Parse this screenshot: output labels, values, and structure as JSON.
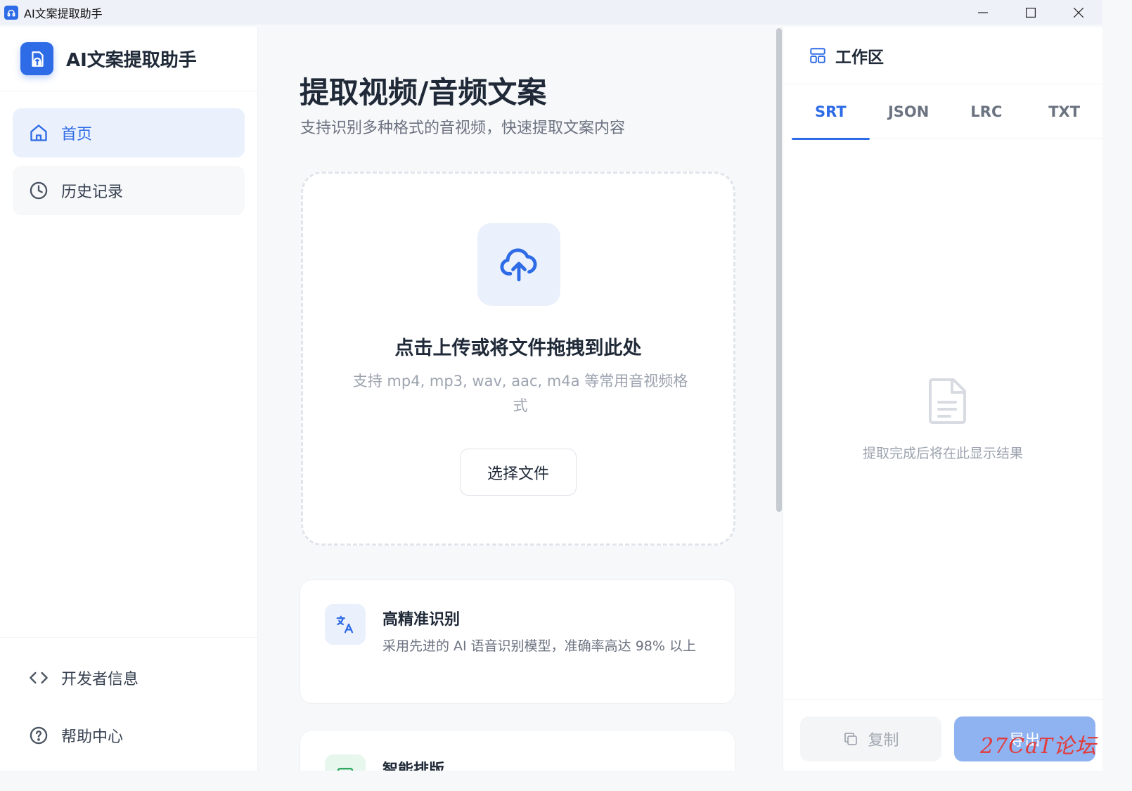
{
  "window": {
    "title": "AI文案提取助手"
  },
  "sidebar": {
    "brand": "AI文案提取助手",
    "items": [
      {
        "label": "首页",
        "icon": "home-icon",
        "active": true
      },
      {
        "label": "历史记录",
        "icon": "clock-icon",
        "active": false
      }
    ],
    "bottom_items": [
      {
        "label": "开发者信息",
        "icon": "code-icon"
      },
      {
        "label": "帮助中心",
        "icon": "help-circle-icon"
      }
    ]
  },
  "main": {
    "title": "提取视频/音频文案",
    "subtitle": "支持识别多种格式的音视频，快速提取文案内容",
    "dropzone": {
      "title": "点击上传或将文件拖拽到此处",
      "hint": "支持 mp4, mp3, wav, aac, m4a 等常用音视频格式",
      "button": "选择文件"
    },
    "features": [
      {
        "title": "高精准识别",
        "desc": "采用先进的 AI 语音识别模型，准确率高达 98% 以上",
        "icon": "translate-icon"
      },
      {
        "title": "智能排版",
        "desc": "",
        "icon": "layout-icon"
      }
    ]
  },
  "workspace": {
    "title": "工作区",
    "tabs": [
      "SRT",
      "JSON",
      "LRC",
      "TXT"
    ],
    "active_tab": "SRT",
    "empty_text": "提取完成后将在此显示结果",
    "copy_label": "复制",
    "export_label": "导出"
  },
  "watermark": "27CaT论坛",
  "colors": {
    "accent": "#2e6be6",
    "accent_light": "#eaf1fd",
    "export_disabled": "#8fb2f0"
  }
}
